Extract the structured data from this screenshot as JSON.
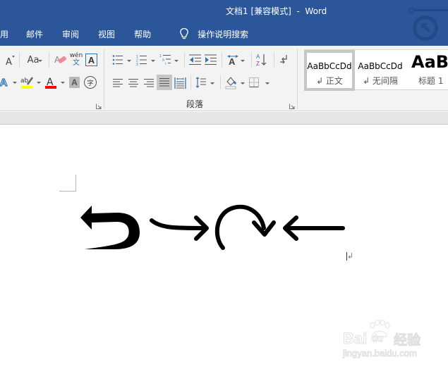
{
  "window": {
    "title": "文档1 [兼容模式]  -  Word"
  },
  "tabs": [
    {
      "label": "用"
    },
    {
      "label": "邮件"
    },
    {
      "label": "审阅"
    },
    {
      "label": "视图"
    },
    {
      "label": "帮助"
    }
  ],
  "tell_me": {
    "icon": "lightbulb-icon",
    "label": "操作说明搜索"
  },
  "ribbon": {
    "font_group": {
      "buttons": [
        {
          "name": "shrink-font",
          "icon": "A▾"
        },
        {
          "name": "change-case",
          "label": "Aa"
        },
        {
          "name": "clear-formatting",
          "icon": "eraser-A"
        },
        {
          "name": "phonetic-guide",
          "label_top": "wén",
          "label_bottom": "文"
        },
        {
          "name": "character-border",
          "label": "A"
        },
        {
          "name": "text-effects",
          "label": "A"
        },
        {
          "name": "highlight",
          "label": "ab",
          "color": "#ffff00"
        },
        {
          "name": "font-color",
          "label": "A",
          "color": "#ff0000"
        },
        {
          "name": "character-shading",
          "label": "A"
        },
        {
          "name": "enclose-characters",
          "label": "字"
        }
      ]
    },
    "paragraph_group": {
      "label": "段落",
      "buttons": [
        {
          "name": "bullets"
        },
        {
          "name": "numbering"
        },
        {
          "name": "multilevel-list"
        },
        {
          "name": "decrease-indent"
        },
        {
          "name": "increase-indent"
        },
        {
          "name": "asian-layout"
        },
        {
          "name": "sort",
          "label_top": "A",
          "label_bottom": "Z"
        },
        {
          "name": "show-marks"
        },
        {
          "name": "align-left"
        },
        {
          "name": "center"
        },
        {
          "name": "align-right"
        },
        {
          "name": "justify",
          "active": true
        },
        {
          "name": "distributed"
        },
        {
          "name": "line-spacing"
        },
        {
          "name": "shading"
        },
        {
          "name": "borders"
        }
      ]
    },
    "styles": [
      {
        "sample": "AaBbCcDd",
        "name": "↲ 正文",
        "selected": true
      },
      {
        "sample": "AaBbCcDd",
        "name": "↲ 无间隔",
        "selected": false
      },
      {
        "sample": "AaBl",
        "name": "标题 1",
        "selected": false
      }
    ]
  },
  "document": {
    "paragraph_mark": "↲",
    "shapes": [
      {
        "name": "u-turn-left-arrow"
      },
      {
        "name": "curved-right-arrow"
      },
      {
        "name": "circular-clockwise-arrow"
      },
      {
        "name": "left-arrow"
      }
    ]
  },
  "watermark": {
    "brand": "Bai",
    "brand_du": "du",
    "brand_cn": "经验",
    "url": "jingyan.baidu.com"
  },
  "colors": {
    "titlebar": "#2b579a",
    "ribbon": "#f3f3f3",
    "highlight_yellow": "#ffff00",
    "font_red": "#ff0000",
    "icon_blue": "#2e75b6"
  }
}
